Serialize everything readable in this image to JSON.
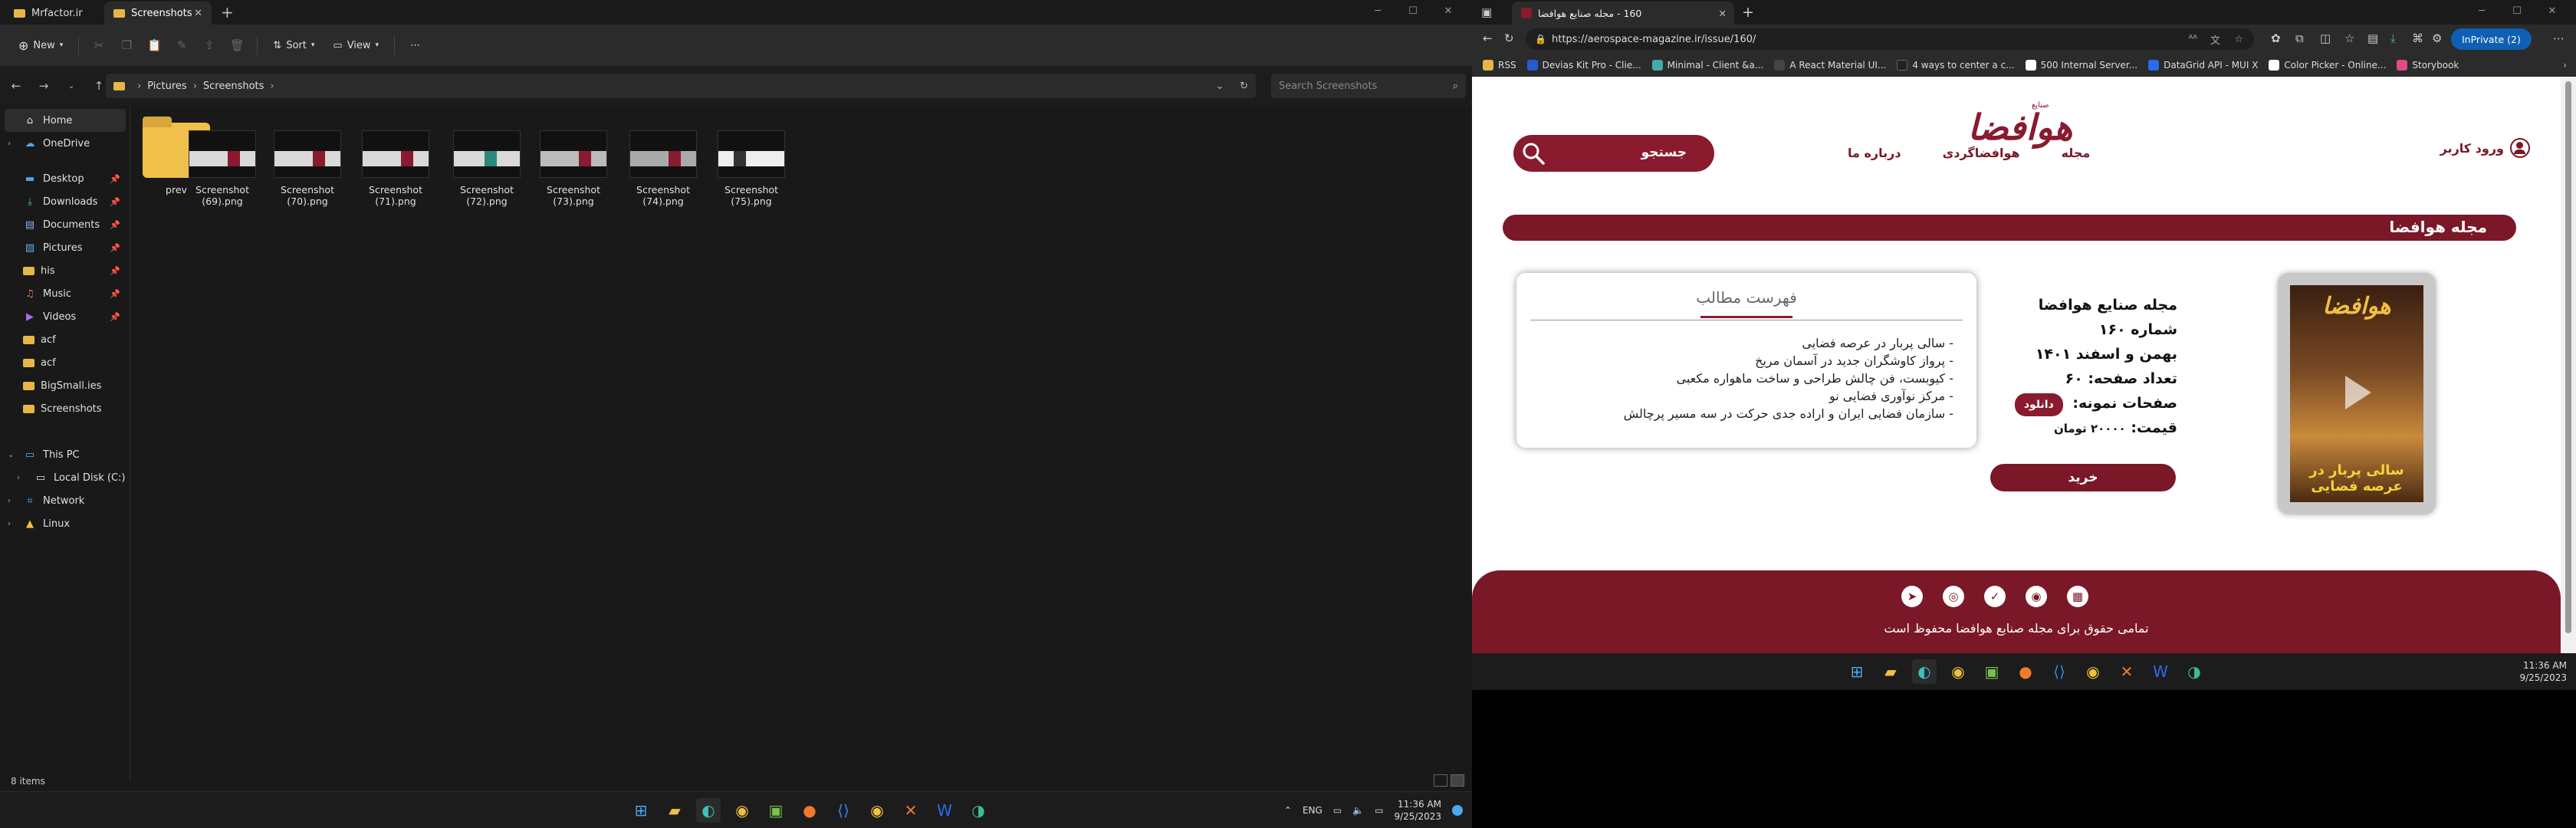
{
  "explorer": {
    "tabs": [
      {
        "label": "Mrfactor.ir"
      },
      {
        "label": "Screenshots"
      }
    ],
    "new_label": "New",
    "sort_label": "Sort",
    "view_label": "View",
    "breadcrumb": [
      "Pictures",
      "Screenshots"
    ],
    "search_placeholder": "Search Screenshots",
    "nav": {
      "home": "Home",
      "onedrive": "OneDrive",
      "desktop": "Desktop",
      "downloads": "Downloads",
      "documents": "Documents",
      "pictures": "Pictures",
      "his": "his",
      "music": "Music",
      "videos": "Videos",
      "acf1": "acf",
      "acf2": "acf",
      "bigsmall": "BigSmall.ies",
      "screenshots": "Screenshots",
      "thispc": "This PC",
      "localdisk": "Local Disk (C:)",
      "network": "Network",
      "linux": "Linux"
    },
    "files": [
      "prev",
      "Screenshot (69).png",
      "Screenshot (70).png",
      "Screenshot (71).png",
      "Screenshot (72).png",
      "Screenshot (73).png",
      "Screenshot (74).png",
      "Screenshot (75).png"
    ],
    "status": "8 items",
    "tray": {
      "lang": "ENG",
      "time": "11:36 AM",
      "date": "9/25/2023"
    }
  },
  "browser": {
    "tab_title": "160 - مجله صنایع هوافضا",
    "url": "https://aerospace-magazine.ir/issue/160/",
    "inprivate": "InPrivate (2)",
    "favorites": [
      "RSS",
      "Devias Kit Pro - Clie...",
      "Minimal - Client &a...",
      "A React Material UI...",
      "4 ways to center a c...",
      "500 Internal Server...",
      "DataGrid API - MUI X",
      "Color Picker - Online...",
      "Storybook"
    ],
    "page": {
      "logo_small": "صنایع",
      "logo": "هوافضا",
      "login": "ورود کاربر",
      "menu": [
        "مجله",
        "هوافضاگردی",
        "درباره ما"
      ],
      "search_label": "جستجو",
      "title": "مجله هوافضا",
      "cover_mast": "هوافضا",
      "cover_tagline": "سالی پربار در عرصه فضایی",
      "info": {
        "name": "مجله صنایع هوافضا",
        "issue": "شماره ۱۶۰",
        "date": "بهمن و اسفند ۱۴۰۱",
        "pages": "تعداد صفحه: ۶۰",
        "sample": "صفحات نمونه:",
        "download": "دانلود",
        "price_label": "قیمت:",
        "price": "۲۰۰۰۰ تومان",
        "buy": "خرید"
      },
      "toc_title": "فهرست مطالب",
      "toc_items": [
        "- سالی پربار در عرصه فضایی",
        "- پرواز کاوشگران جدید در آسمان مریخ",
        "- کیوبست، فن چالش طراحی و ساخت ماهواره مکعبی",
        "- مرکز نوآوری فضایی نو",
        "- سازمان فضایی ایران و اراده جدی حرکت در سه مسیر پرچالش"
      ],
      "footer_copy": "تمامی حقوق برای مجله صنایع هوافضا محفوظ است"
    },
    "clock": {
      "time": "11:36 AM",
      "date": "9/25/2023"
    }
  },
  "colors": {
    "brand": "#8a1a2e",
    "inprivate": "#0f5fb4"
  }
}
